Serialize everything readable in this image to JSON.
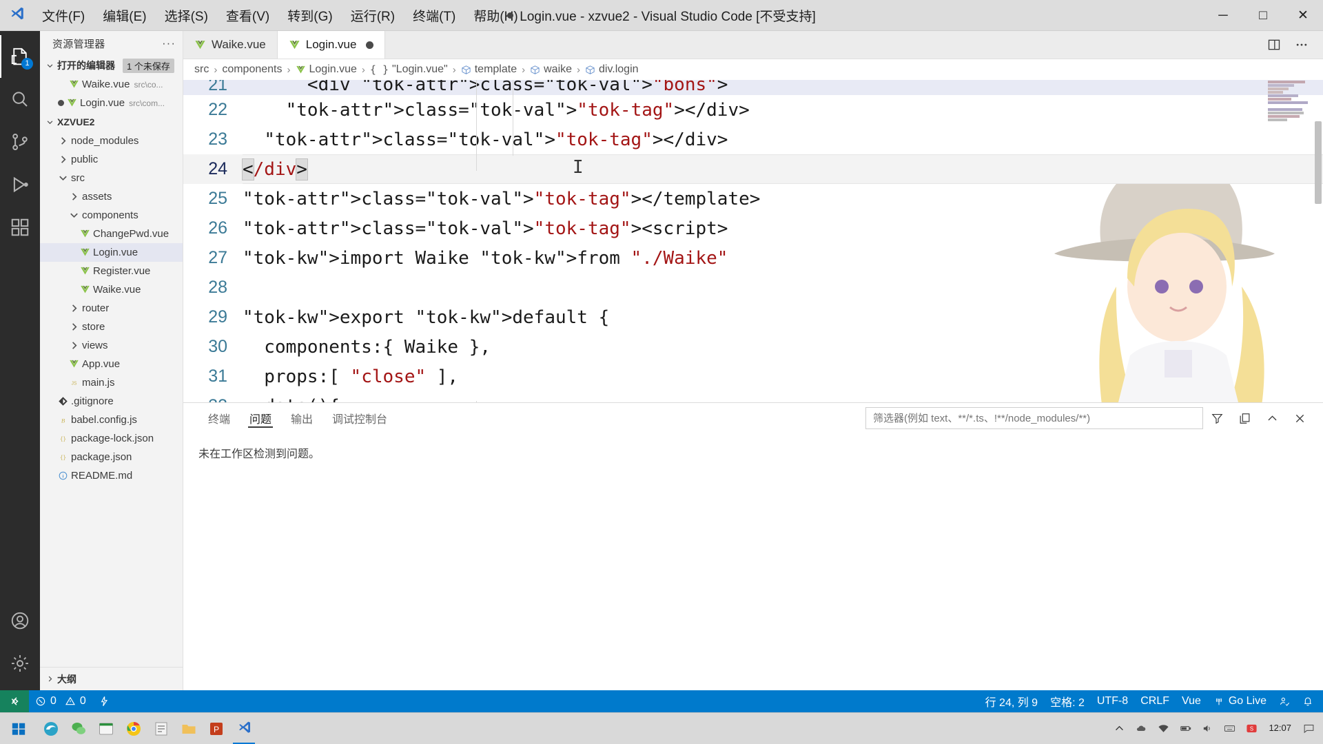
{
  "titlebar": {
    "menus": [
      "文件(F)",
      "编辑(E)",
      "选择(S)",
      "查看(V)",
      "转到(G)",
      "运行(R)",
      "终端(T)",
      "帮助(H)"
    ],
    "window_title": "Login.vue - xzvue2 - Visual Studio Code [不受支持]",
    "controls": {
      "minimize": "─",
      "maximize": "□",
      "close": "✕"
    }
  },
  "activitybar": {
    "items": [
      {
        "name": "explorer",
        "badge": "1"
      },
      {
        "name": "search",
        "badge": ""
      },
      {
        "name": "source-control",
        "badge": ""
      },
      {
        "name": "run-debug",
        "badge": ""
      },
      {
        "name": "extensions",
        "badge": ""
      }
    ],
    "bottom": [
      {
        "name": "accounts"
      },
      {
        "name": "settings"
      }
    ]
  },
  "sidebar": {
    "title": "资源管理器",
    "more_label": "···",
    "open_editors": {
      "label": "打开的编辑器",
      "badge": "1 个未保存",
      "items": [
        {
          "name": "Waike.vue",
          "path": "src\\co...",
          "dirty": false,
          "icon": "vue-icon",
          "selected": false
        },
        {
          "name": "Login.vue",
          "path": "src\\com...",
          "dirty": true,
          "icon": "vue-icon",
          "selected": false
        }
      ]
    },
    "workspace": {
      "label": "XZVUE2",
      "items": [
        {
          "label": "node_modules",
          "type": "folder",
          "expanded": false,
          "depth": 1,
          "icon": "chevron-right-icon"
        },
        {
          "label": "public",
          "type": "folder",
          "expanded": false,
          "depth": 1,
          "icon": "chevron-right-icon"
        },
        {
          "label": "src",
          "type": "folder",
          "expanded": true,
          "depth": 1,
          "icon": "chevron-down-icon"
        },
        {
          "label": "assets",
          "type": "folder",
          "expanded": false,
          "depth": 2,
          "icon": "chevron-right-icon"
        },
        {
          "label": "components",
          "type": "folder",
          "expanded": true,
          "depth": 2,
          "icon": "chevron-down-icon"
        },
        {
          "label": "ChangePwd.vue",
          "type": "file",
          "depth": 3,
          "icon": "vue-icon"
        },
        {
          "label": "Login.vue",
          "type": "file",
          "depth": 3,
          "icon": "vue-icon",
          "selected": true
        },
        {
          "label": "Register.vue",
          "type": "file",
          "depth": 3,
          "icon": "vue-icon"
        },
        {
          "label": "Waike.vue",
          "type": "file",
          "depth": 3,
          "icon": "vue-icon"
        },
        {
          "label": "router",
          "type": "folder",
          "expanded": false,
          "depth": 2,
          "icon": "chevron-right-icon"
        },
        {
          "label": "store",
          "type": "folder",
          "expanded": false,
          "depth": 2,
          "icon": "chevron-right-icon"
        },
        {
          "label": "views",
          "type": "folder",
          "expanded": false,
          "depth": 2,
          "icon": "chevron-right-icon"
        },
        {
          "label": "App.vue",
          "type": "file",
          "depth": 2,
          "icon": "vue-icon"
        },
        {
          "label": "main.js",
          "type": "file",
          "depth": 2,
          "icon": "js-icon"
        },
        {
          "label": ".gitignore",
          "type": "file",
          "depth": 1,
          "icon": "git-icon"
        },
        {
          "label": "babel.config.js",
          "type": "file",
          "depth": 1,
          "icon": "babel-icon"
        },
        {
          "label": "package-lock.json",
          "type": "file",
          "depth": 1,
          "icon": "json-icon"
        },
        {
          "label": "package.json",
          "type": "file",
          "depth": 1,
          "icon": "json-icon"
        },
        {
          "label": "README.md",
          "type": "file",
          "depth": 1,
          "icon": "info-icon"
        }
      ]
    },
    "outline_label": "大纲"
  },
  "editor": {
    "tabs": [
      {
        "label": "Waike.vue",
        "icon": "vue-icon",
        "active": false,
        "dirty": false
      },
      {
        "label": "Login.vue",
        "icon": "vue-icon",
        "active": true,
        "dirty": true
      }
    ],
    "actions": [
      "split-editor-icon",
      "more-actions-icon"
    ],
    "breadcrumb": [
      {
        "label": "src",
        "icon": ""
      },
      {
        "label": "components",
        "icon": ""
      },
      {
        "label": "Login.vue",
        "icon": "vue-icon"
      },
      {
        "label": "\"Login.vue\"",
        "icon": "braces-icon"
      },
      {
        "label": "template",
        "icon": "symbol-cube-icon"
      },
      {
        "label": "waike",
        "icon": "symbol-cube-icon"
      },
      {
        "label": "div.login",
        "icon": "symbol-cube-icon"
      }
    ],
    "code_lines": [
      {
        "no": "21",
        "partial": true,
        "text": "      <div class=\"bons\">"
      },
      {
        "no": "22",
        "text": "    </div>"
      },
      {
        "no": "23",
        "text": "  </div>"
      },
      {
        "no": "24",
        "text": "</div>",
        "current": true
      },
      {
        "no": "25",
        "text": "</template>"
      },
      {
        "no": "26",
        "text": "<script>"
      },
      {
        "no": "27",
        "text": "import Waike from \"./Waike\""
      },
      {
        "no": "28",
        "text": ""
      },
      {
        "no": "29",
        "text": "export default {"
      },
      {
        "no": "30",
        "text": "  components:{ Waike },"
      },
      {
        "no": "31",
        "text": "  props:[ \"close\" ],"
      },
      {
        "no": "32",
        "text": "  data(){"
      }
    ]
  },
  "panel": {
    "tabs": [
      {
        "label": "终端",
        "active": false
      },
      {
        "label": "问题",
        "active": true
      },
      {
        "label": "输出",
        "active": false
      },
      {
        "label": "调试控制台",
        "active": false
      }
    ],
    "filter_placeholder": "筛选器(例如 text、**/*.ts、!**/node_modules/**)",
    "filter_value": "",
    "actions": [
      "filter-icon",
      "copy-icon",
      "collapse-icon",
      "close-icon"
    ],
    "message": "未在工作区检测到问题。"
  },
  "statusbar": {
    "remote_icon": "remote-icon",
    "errors": "0",
    "warnings": "0",
    "ports_icon": "radio-tower-icon",
    "position": "行 24, 列 9",
    "indentation": "空格: 2",
    "encoding": "UTF-8",
    "eol": "CRLF",
    "language": "Vue",
    "golive": "Go Live",
    "feedback_icon": "feedback-icon",
    "bell_icon": "bell-icon"
  },
  "taskbar": {
    "start_icon": "windows-start-icon",
    "apps": [
      "edge-icon",
      "wechat-icon",
      "explorer-icon",
      "chrome-icon",
      "notes-icon",
      "folder-icon",
      "powerpoint-icon",
      "vscode-icon"
    ],
    "tray": [
      "chevron-up-icon",
      "onedrive-icon",
      "network-icon",
      "battery-icon",
      "volume-icon",
      "keyboard-icon",
      "ime-icon",
      "shield-icon"
    ],
    "time": "12:07",
    "notification_icon": "notification-icon"
  },
  "colors": {
    "accent": "#007acc",
    "titlebar_bg": "#dddddd",
    "sidebar_bg": "#f3f3f3",
    "activitybar_bg": "#2c2c2c",
    "editor_bg": "#ffffff",
    "remote_green": "#16825d",
    "vue_green": "#81c784",
    "tag_red": "#a31515",
    "keyword_blue": "#0000ff"
  }
}
